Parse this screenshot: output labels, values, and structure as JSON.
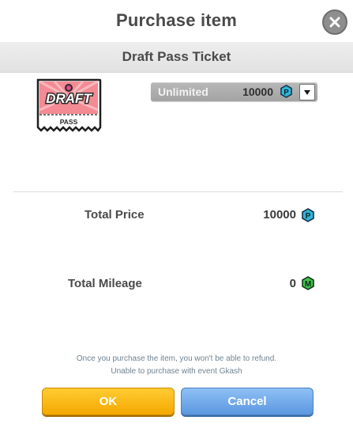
{
  "dialog": {
    "title": "Purchase item",
    "item_name": "Draft Pass Ticket"
  },
  "item_image": {
    "main_text": "DRAFT",
    "sub_text": "PASS"
  },
  "duration_select": {
    "selected_label": "Unlimited",
    "price": "10000",
    "currency_icon": "p-coin-icon",
    "currency_glyph": "P"
  },
  "totals": {
    "price_label": "Total Price",
    "price_value": "10000",
    "mileage_label": "Total Mileage",
    "mileage_value": "0",
    "mileage_glyph": "M"
  },
  "notices": {
    "line1": "Once you purchase the item, you won't be able to refund.",
    "line2": "Unable to purchase with event Gkash"
  },
  "buttons": {
    "ok_label": "OK",
    "cancel_label": "Cancel"
  },
  "colors": {
    "ok_button": "#f5a800",
    "cancel_button": "#5b97e0",
    "p_coin": "#2fb6d6",
    "m_coin": "#3cc44a",
    "draft_ticket": "#f17b86"
  }
}
